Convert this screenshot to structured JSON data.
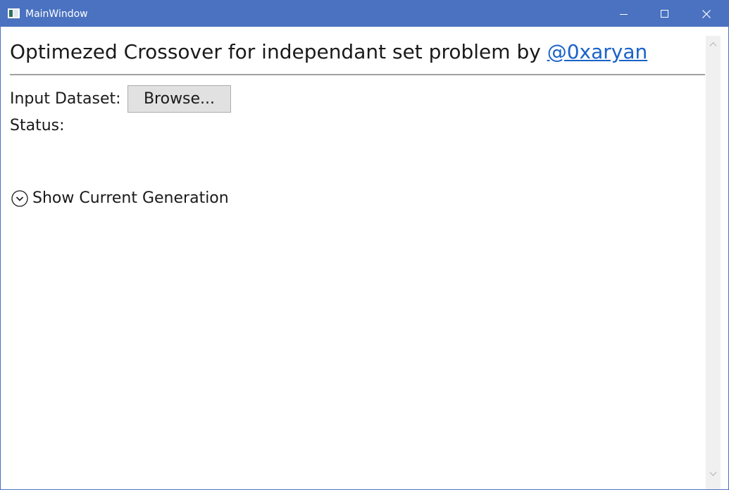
{
  "window": {
    "title": "MainWindow",
    "titlebar_color": "#4a72c0",
    "icons": {
      "app": "window-app-icon",
      "minimize": "minimize-icon",
      "maximize": "maximize-icon",
      "close": "close-icon"
    }
  },
  "header": {
    "title": "Optimezed Crossover for independant set problem by ",
    "author_link": "@0xaryan",
    "link_color": "#1a62c8"
  },
  "form": {
    "input_dataset_label": "Input Dataset:",
    "browse_label": "Browse...",
    "status_label": "Status:"
  },
  "expander": {
    "label": "Show Current Generation",
    "icon": "chevron-down-circle-icon",
    "expanded": false
  },
  "scrollbar": {
    "up_icon": "scroll-up-arrow-icon",
    "down_icon": "scroll-down-arrow-icon"
  }
}
